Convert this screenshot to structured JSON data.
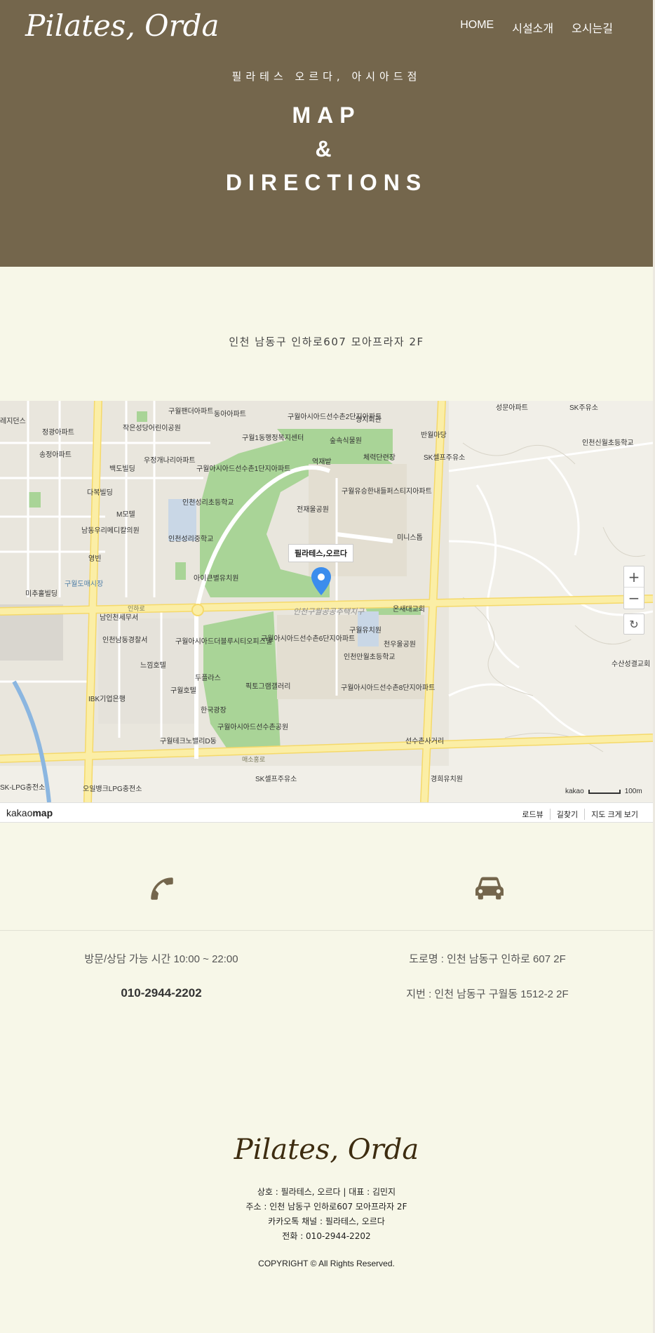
{
  "header": {
    "logo": "Pilates, Orda",
    "nav": [
      "HOME",
      "시설소개",
      "오시는길"
    ],
    "subtitle": "필라테스 오르다, 아시아드점",
    "title_lines": [
      "MAP",
      "&",
      "DIRECTIONS"
    ]
  },
  "address_line": "인천 남동구 인하로607 모아프라자 2F",
  "map": {
    "marker_label": "필라테스,오르다",
    "labels": [
      "구월팬더아파트",
      "동아아파트",
      "구월아시아드선수촌2단지아파트",
      "쌍지회관",
      "SK주유소",
      "성문아파트",
      "레지던스",
      "정광아파트",
      "작은성당어린이공원",
      "구월1동행정복지센터",
      "숲속식물원",
      "반월마당",
      "인천신월초등학교",
      "송정아파트",
      "백도빌딩",
      "우정개나리아파트",
      "구월아시아드선수촌1단지아파트",
      "체력단련장",
      "SK셀프주유소",
      "역재밭",
      "다복빌딩",
      "인천성리초등학교",
      "구월유승한내들퍼스티지아파트",
      "전재울공원",
      "M모텔",
      "남동우리메디칼의원",
      "인천성리중학교",
      "미니스톱",
      "영빈",
      "아이큰별유치원",
      "구월도매시장",
      "미추홀빌딩",
      "남인천세무서",
      "온새대교회",
      "인천구월공공주택지구",
      "구월아시아드선수촌6단지아파트",
      "구월유치원",
      "인천남동경찰서",
      "구월아시아드더블루시티오피스텔",
      "천우울공원",
      "인천만월초등학교",
      "느낌호텔",
      "두플라스",
      "IBK기업은행",
      "구월호텔",
      "픽토그램갤러리",
      "구월아시아드선수촌8단지아파트",
      "수산성결교회",
      "한국광장",
      "구월아시아드선수촌공원",
      "구월테크노밸리D동",
      "선수촌사거리",
      "SK셀프주유소",
      "경희유치원",
      "SK-LPG충전소",
      "오일뱅크LPG충전소",
      "매소홍로",
      "인하로"
    ],
    "scale_text": "100m",
    "kakao_small": "kakao",
    "brand_regular": "kakao",
    "brand_bold": "map",
    "footer_links": [
      "로드뷰",
      "길찾기",
      "지도 크게 보기"
    ],
    "zoom_in": "+",
    "zoom_out": "−",
    "refresh": "↻"
  },
  "contact": {
    "hours": "방문/상담 가능 시간 10:00 ~ 22:00",
    "phone": "010-2944-2202",
    "road_address": "도로명 : 인천 남동구 인하로 607 2F",
    "lot_address": "지번 : 인천 남동구 구월동 1512-2 2F",
    "phone_icon": "phone-icon",
    "car_icon": "car-icon",
    "icon_color": "#74664c"
  },
  "footer": {
    "logo": "Pilates, Orda",
    "lines": [
      "상호 : 필라테스, 오르다 | 대표 : 김민지",
      "주소 : 인천 남동구 인하로607 모아프라자 2F",
      "카카오톡 채널 : 필라테스, 오르다",
      "전화 : 010-2944-2202"
    ],
    "copyright": "COPYRIGHT © All Rights Reserved."
  },
  "colors": {
    "hero_bg": "#74664c",
    "page_bg": "#f7f7e8",
    "park_green": "#a9d497",
    "road_yellow": "#fbeea6",
    "marker_blue": "#3b8ded"
  }
}
